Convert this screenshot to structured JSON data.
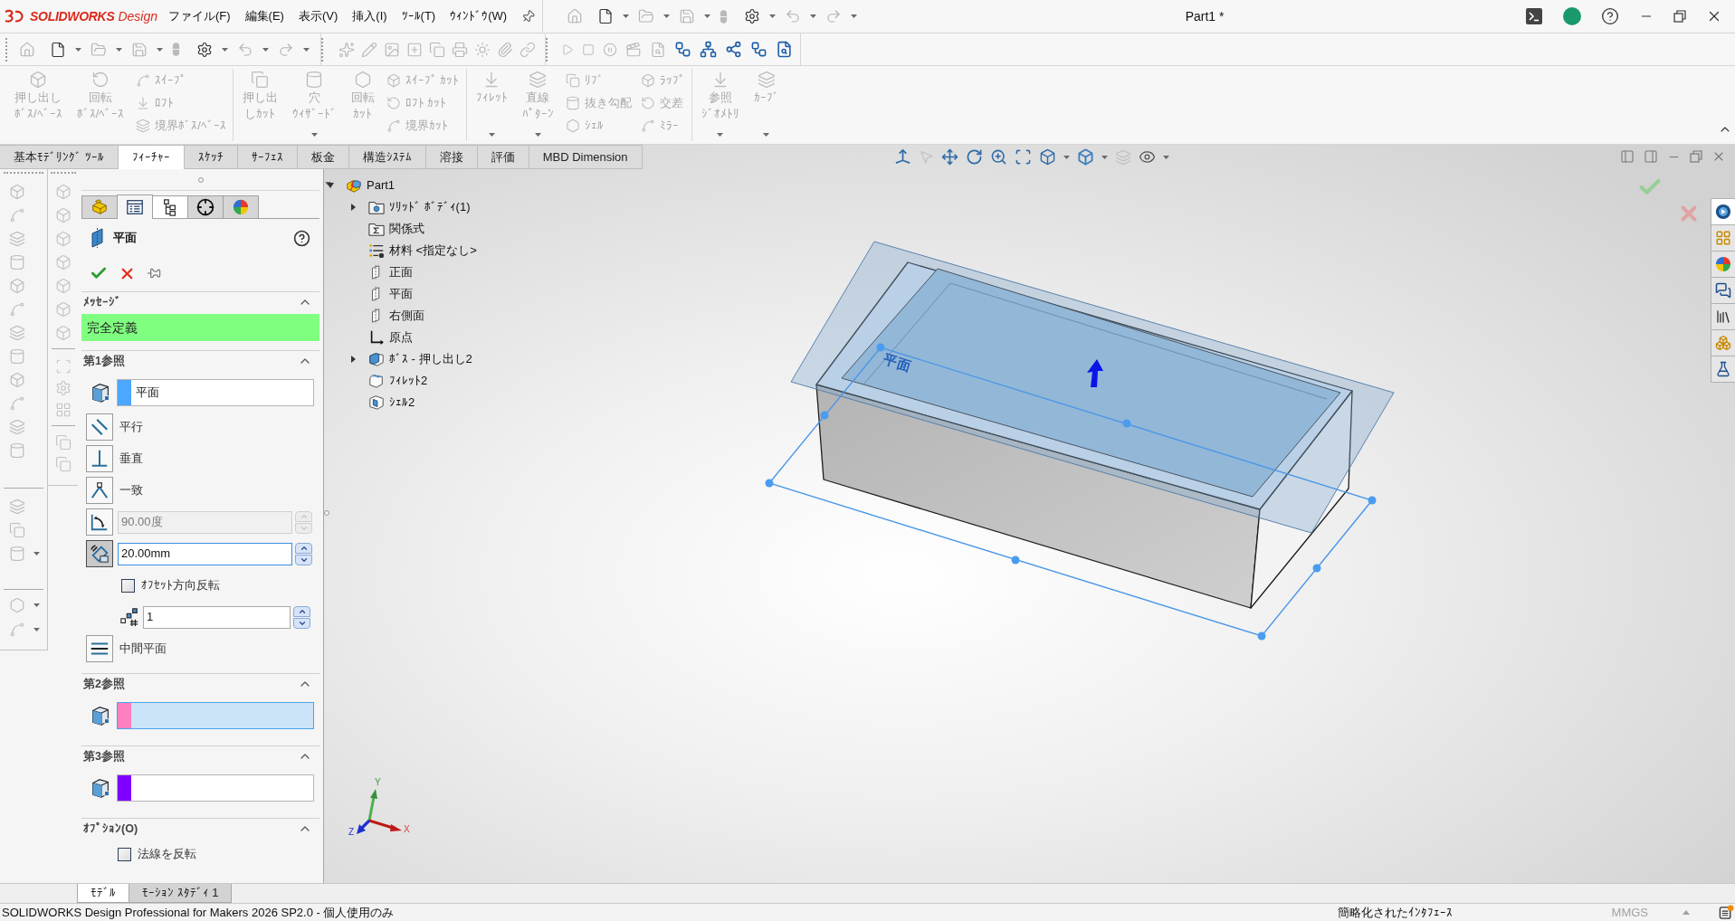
{
  "title_bar": {
    "brand": {
      "name": "SOLIDWORKS",
      "edition": "Design"
    },
    "menu": [
      "ファイル(F)",
      "編集(E)",
      "表示(V)",
      "挿入(I)",
      "ﾂｰﾙ(T)",
      "ｳｨﾝﾄﾞｳ(W)"
    ],
    "document_title": "Part1 *"
  },
  "ribbon": {
    "groups": [
      {
        "items": [
          {
            "kind": "large",
            "lines": [
              "押し出し",
              "ﾎﾞｽ/ﾍﾞｰｽ"
            ],
            "disabled": true,
            "dropdown": false
          },
          {
            "kind": "large",
            "lines": [
              "回転",
              "ﾎﾞｽ/ﾍﾞｰｽ"
            ],
            "disabled": true,
            "dropdown": false
          },
          {
            "kind": "stack",
            "items": [
              {
                "label": "ｽｲｰﾌﾟ",
                "disabled": true
              },
              {
                "label": "ﾛﾌﾄ",
                "disabled": true
              },
              {
                "label": "境界ﾎﾞｽ/ﾍﾞｰｽ",
                "disabled": true
              }
            ]
          }
        ]
      },
      {
        "items": [
          {
            "kind": "large",
            "lines": [
              "押し出",
              "しｶｯﾄ"
            ],
            "disabled": true,
            "dropdown": false
          },
          {
            "kind": "large",
            "lines": [
              "穴",
              "ｳｨｻﾞｰﾄﾞ"
            ],
            "disabled": true,
            "dropdown": true
          },
          {
            "kind": "large",
            "lines": [
              "回転",
              "ｶｯﾄ"
            ],
            "disabled": true,
            "dropdown": false
          },
          {
            "kind": "stack",
            "items": [
              {
                "label": "ｽｲｰﾌﾟ ｶｯﾄ",
                "disabled": true
              },
              {
                "label": "ﾛﾌﾄ ｶｯﾄ",
                "disabled": true
              },
              {
                "label": "境界ｶｯﾄ",
                "disabled": true
              }
            ]
          }
        ]
      },
      {
        "items": [
          {
            "kind": "large",
            "lines": [
              "ﾌｨﾚｯﾄ"
            ],
            "disabled": true,
            "dropdown": true
          },
          {
            "kind": "large",
            "lines": [
              "直線",
              "ﾊﾟﾀｰﾝ"
            ],
            "disabled": true,
            "dropdown": true
          },
          {
            "kind": "stack",
            "items": [
              {
                "label": "ﾘﾌﾞ",
                "disabled": true
              },
              {
                "label": "抜き勾配",
                "disabled": true
              },
              {
                "label": "ｼｪﾙ",
                "disabled": true
              }
            ]
          },
          {
            "kind": "stack",
            "items": [
              {
                "label": "ﾗｯﾌﾟ",
                "disabled": true
              },
              {
                "label": "交差",
                "disabled": true
              },
              {
                "label": "ﾐﾗｰ",
                "disabled": true
              }
            ]
          }
        ]
      },
      {
        "items": [
          {
            "kind": "large",
            "lines": [
              "参照",
              "ｼﾞｵﾒﾄﾘ"
            ],
            "disabled": true,
            "dropdown": true
          },
          {
            "kind": "large",
            "lines": [
              "ｶｰﾌﾞ"
            ],
            "disabled": true,
            "dropdown": true
          }
        ]
      }
    ]
  },
  "command_tabs": [
    {
      "label": "基本ﾓﾃﾞﾘﾝｸﾞ ﾂｰﾙ",
      "selected": false
    },
    {
      "label": "ﾌｨｰﾁｬｰ",
      "selected": true
    },
    {
      "label": "ｽｹｯﾁ",
      "selected": false
    },
    {
      "label": "ｻｰﾌｪｽ",
      "selected": false
    },
    {
      "label": "板金",
      "selected": false
    },
    {
      "label": "構造ｼｽﾃﾑ",
      "selected": false
    },
    {
      "label": "溶接",
      "selected": false
    },
    {
      "label": "評価",
      "selected": false
    },
    {
      "label": "MBD Dimension",
      "selected": false
    }
  ],
  "property_manager": {
    "tabs": [
      {
        "kind": "feature-tree",
        "selected": false,
        "hovered": false
      },
      {
        "kind": "property",
        "selected": true,
        "hovered": false
      },
      {
        "kind": "configuration",
        "selected": false,
        "hovered": true
      },
      {
        "kind": "dimxpert",
        "selected": false,
        "hovered": false
      },
      {
        "kind": "display",
        "selected": false,
        "hovered": false
      }
    ],
    "title": "平面",
    "sections": [
      {
        "kind": "message",
        "title": "ﾒｯｾｰｼﾞ",
        "expanded": true,
        "message": "完全定義"
      },
      {
        "kind": "reference",
        "title": "第1参照",
        "expanded": true,
        "selection": {
          "value": "平面",
          "color": "#4da6ff",
          "selected": false
        },
        "options": [
          {
            "kind": "toggle",
            "label": "平行",
            "pressed": false
          },
          {
            "kind": "toggle",
            "label": "垂直",
            "pressed": false
          },
          {
            "kind": "toggle",
            "label": "一致",
            "pressed": false
          },
          {
            "kind": "number",
            "value": "90.00度",
            "pressed": false,
            "disabled": true
          },
          {
            "kind": "number",
            "value": "20.00mm",
            "pressed": true,
            "disabled": false
          },
          {
            "kind": "checkbox",
            "label": "ｵﾌｾｯﾄ方向反転",
            "checked": false
          },
          {
            "kind": "count",
            "value": "1"
          },
          {
            "kind": "toggle",
            "label": "中間平面",
            "pressed": false
          }
        ]
      },
      {
        "kind": "reference",
        "title": "第2参照",
        "expanded": true,
        "selection": {
          "color": "#ff80c0",
          "selected": true
        }
      },
      {
        "kind": "reference",
        "title": "第3参照",
        "expanded": true,
        "selection": {
          "color": "#8000ff",
          "selected": false
        }
      },
      {
        "kind": "options",
        "title": "ｵﾌﾟｼｮﾝ(O)",
        "expanded": true,
        "options": [
          {
            "kind": "checkbox",
            "label": "法線を反転",
            "checked": false
          }
        ]
      }
    ]
  },
  "feature_tree": {
    "root": {
      "label": "Part1",
      "kind": "part",
      "expanded": true,
      "children": [
        {
          "label": "ｿﾘｯﾄﾞ ﾎﾞﾃﾞｨ(1)",
          "kind": "solid-bodies",
          "expanded": false
        },
        {
          "label": "関係式",
          "kind": "equations"
        },
        {
          "label": "材料 <指定なし>",
          "kind": "material"
        },
        {
          "label": "正面",
          "kind": "plane"
        },
        {
          "label": "平面",
          "kind": "plane"
        },
        {
          "label": "右側面",
          "kind": "plane"
        },
        {
          "label": "原点",
          "kind": "origin"
        },
        {
          "label": "ﾎﾞｽ - 押し出し2",
          "kind": "extrude",
          "expanded": false
        },
        {
          "label": "ﾌｨﾚｯﾄ2",
          "kind": "fillet"
        },
        {
          "label": "ｼｪﾙ2",
          "kind": "shell"
        }
      ]
    }
  },
  "graphics": {
    "plane_label": "平面",
    "triad": {
      "x_label": "X",
      "y_label": "Y",
      "z_label": "Z"
    }
  },
  "task_pane": {
    "tabs": [
      {
        "kind": "resources",
        "selected": true
      },
      {
        "kind": "design-library",
        "selected": false
      },
      {
        "kind": "appearances",
        "selected": false
      },
      {
        "kind": "forum",
        "selected": false
      },
      {
        "kind": "file-explorer",
        "selected": false
      },
      {
        "kind": "view-palette",
        "selected": false
      },
      {
        "kind": "custom-properties",
        "selected": false
      }
    ]
  },
  "bottom_tabs": [
    {
      "label": "ﾓﾃﾞﾙ",
      "selected": true
    },
    {
      "label": "ﾓｰｼｮﾝ ｽﾀﾃﾞｨ 1",
      "selected": false
    }
  ],
  "status_bar": {
    "product": "SOLIDWORKS Design Professional for Makers 2026 SP2.0 - 個人使用のみ",
    "interface": "簡略化されたｲﾝﾀﾌｪｰｽ",
    "units": {
      "label": "MMGS",
      "disabled": true
    }
  }
}
